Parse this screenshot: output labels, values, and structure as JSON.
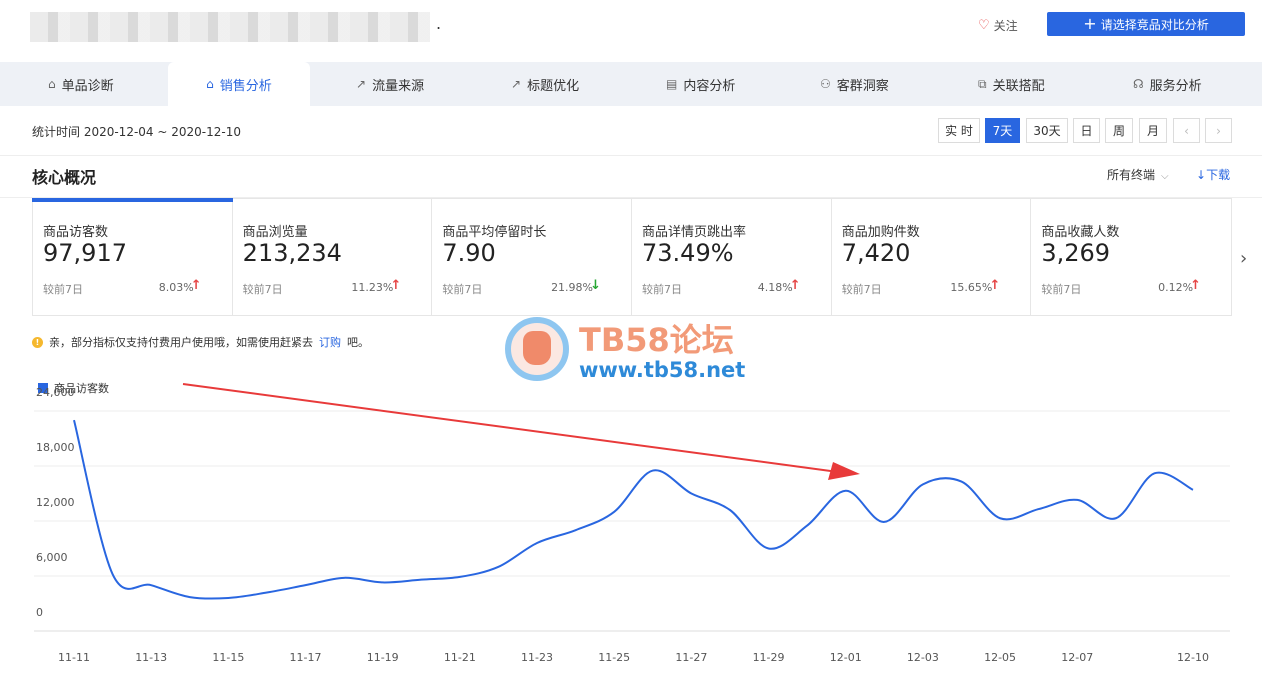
{
  "header": {
    "follow_label": "关注",
    "compare_label": "请选择竞品对比分析"
  },
  "tabs": [
    {
      "label": "单品诊断",
      "icon": "bag-icon"
    },
    {
      "label": "销售分析",
      "icon": "bag-icon"
    },
    {
      "label": "流量来源",
      "icon": "line-chart-icon"
    },
    {
      "label": "标题优化",
      "icon": "line-chart-icon"
    },
    {
      "label": "内容分析",
      "icon": "document-icon"
    },
    {
      "label": "客群洞察",
      "icon": "users-icon"
    },
    {
      "label": "关联搭配",
      "icon": "link-icon"
    },
    {
      "label": "服务分析",
      "icon": "headset-icon"
    }
  ],
  "active_tab": "销售分析",
  "datebar": {
    "stat_time": "统计时间 2020-12-04 ~ 2020-12-10",
    "periods": [
      "实 时",
      "7天",
      "30天",
      "日",
      "周",
      "月"
    ],
    "active_period": "7天",
    "prev_label": "‹",
    "next_label": "›"
  },
  "section": {
    "title": "核心概况",
    "terminal": "所有终端",
    "download": "下载"
  },
  "metrics": [
    {
      "title": "商品访客数",
      "value": "97,917",
      "compare": "较前7日",
      "pct": "8.03%",
      "trend": "up"
    },
    {
      "title": "商品浏览量",
      "value": "213,234",
      "compare": "较前7日",
      "pct": "11.23%",
      "trend": "up"
    },
    {
      "title": "商品平均停留时长",
      "value": "7.90",
      "compare": "较前7日",
      "pct": "21.98%",
      "trend": "down"
    },
    {
      "title": "商品详情页跳出率",
      "value": "73.49%",
      "compare": "较前7日",
      "pct": "4.18%",
      "trend": "up"
    },
    {
      "title": "商品加购件数",
      "value": "7,420",
      "compare": "较前7日",
      "pct": "15.65%",
      "trend": "up"
    },
    {
      "title": "商品收藏人数",
      "value": "3,269",
      "compare": "较前7日",
      "pct": "0.12%",
      "trend": "up"
    }
  ],
  "notice": {
    "text": "亲，部分指标仅支持付费用户使用哦，如需使用赶紧去",
    "link": "订购",
    "suffix": "吧。"
  },
  "watermark": {
    "line1": "TB58论坛",
    "line2": "www.tb58.net"
  },
  "colors": {
    "accent": "#2966e0",
    "up": "#e54545",
    "down": "#26a632",
    "annotation_arrow": "#e83a3a"
  },
  "chart_data": {
    "type": "line",
    "series": [
      {
        "name": "商品访客数",
        "x": [
          "11-11",
          "11-12",
          "11-13",
          "11-14",
          "11-15",
          "11-16",
          "11-17",
          "11-18",
          "11-19",
          "11-20",
          "11-21",
          "11-22",
          "11-23",
          "11-24",
          "11-25",
          "11-26",
          "11-27",
          "11-28",
          "11-29",
          "11-30",
          "12-01",
          "12-02",
          "12-03",
          "12-04",
          "12-05",
          "12-06",
          "12-07",
          "12-08",
          "12-09",
          "12-10"
        ],
        "values": [
          23000,
          6200,
          5000,
          3700,
          3600,
          4200,
          5000,
          5800,
          5300,
          5600,
          5900,
          7000,
          9600,
          11000,
          13000,
          17500,
          15000,
          13200,
          9000,
          11500,
          15300,
          11900,
          16000,
          16300,
          12300,
          13300,
          14300,
          12300,
          17200,
          15400
        ]
      }
    ],
    "x_tick_labels": [
      "11-11",
      "11-13",
      "11-15",
      "11-17",
      "11-19",
      "11-21",
      "11-23",
      "11-25",
      "11-27",
      "11-29",
      "12-01",
      "12-03",
      "12-05",
      "12-07",
      "12-10"
    ],
    "y_ticks": [
      0,
      6000,
      12000,
      18000,
      24000
    ],
    "y_tick_labels": [
      "0",
      "6,000",
      "12,000",
      "18,000",
      "24,000"
    ],
    "ylim": [
      0,
      24000
    ],
    "grid": true,
    "legend": "top-left"
  }
}
